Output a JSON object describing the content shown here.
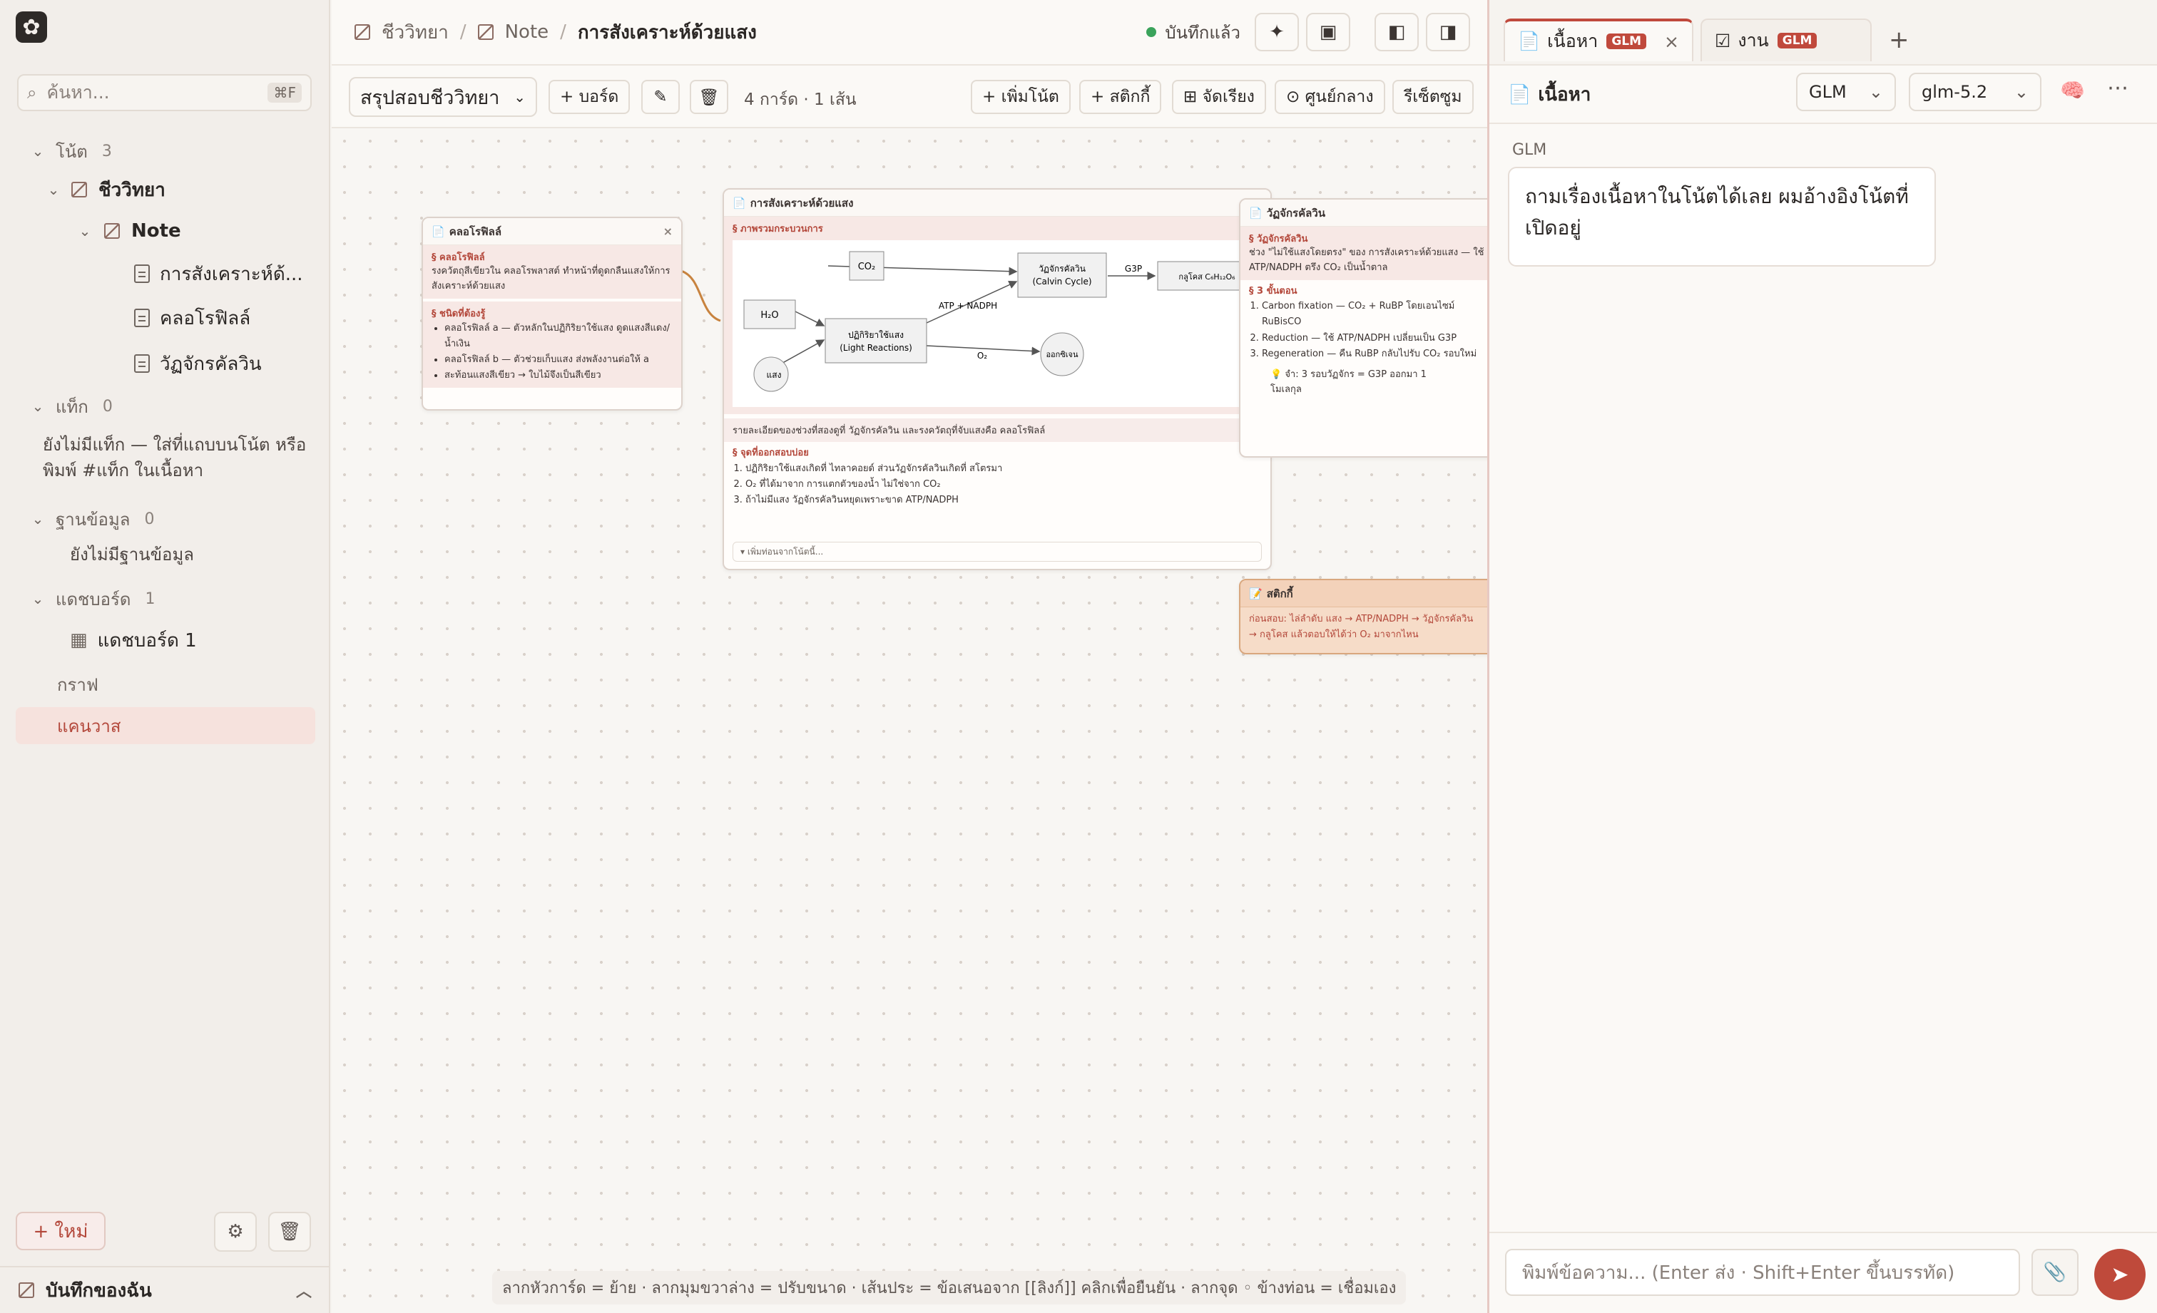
{
  "sidebar": {
    "search_placeholder": "ค้นหา...",
    "search_shortcut": "⌘F",
    "notes": {
      "label": "โน้ต",
      "count": "3",
      "folder": "ชีววิทยา",
      "subfolder": "Note",
      "items": [
        "การสังเคราะห์ด้...",
        "คลอโรฟิลล์",
        "วัฏจักรคัลวิน"
      ]
    },
    "tags": {
      "label": "แท็ก",
      "count": "0",
      "empty": "ยังไม่มีแท็ก — ใส่ที่แถบบนโน้ต หรือพิมพ์ #แท็ก ในเนื้อหา"
    },
    "databases": {
      "label": "ฐานข้อมูล",
      "count": "0",
      "empty": "ยังไม่มีฐานข้อมูล"
    },
    "dashboards": {
      "label": "แดชบอร์ด",
      "count": "1",
      "item": "แดชบอร์ด 1"
    },
    "graph": "กราฟ",
    "canvas": "แคนวาส",
    "new_button": "+ ใหม่",
    "vault_name": "บันทึกของฉัน"
  },
  "header": {
    "breadcrumb": [
      "ชีววิทยา",
      "Note",
      "การสังเคราะห์ด้วยแสง"
    ],
    "save_status": "บันทึกแล้ว"
  },
  "toolbar": {
    "board_select": "สรุปสอบชีววิทยา",
    "add_board": "+ บอร์ด",
    "edit": "✎",
    "delete": "🗑",
    "summary": "4 การ์ด · 1 เส้น",
    "add_note": "+ เพิ่มโน้ต",
    "add_sticky": "+ สติกกี้",
    "arrange": "⊞ จัดเรียง",
    "center": "⊙ ศูนย์กลาง",
    "reset_zoom": "รีเซ็ตซูม"
  },
  "canvas": {
    "card_chloro": {
      "title": "คลอโรฟิลล์",
      "sec1": "§ คลอโรฟิลล์",
      "body1": "รงควัตถุสีเขียวใน คลอโรพลาสต์ ทำหน้าที่ดูดกลืนแสงให้การสังเคราะห์ด้วยแสง",
      "sec2": "§ ชนิดที่ต้องรู้",
      "list": [
        "คลอโรฟิลล์ a — ตัวหลักในปฏิกิริยาใช้แสง ดูดแสงสีแดง/น้ำเงิน",
        "คลอโรฟิลล์ b — ตัวช่วยเก็บแสง ส่งพลังงานต่อให้ a",
        "สะท้อนแสงสีเขียว → ใบไม้จึงเป็นสีเขียว"
      ]
    },
    "card_photo": {
      "title": "การสังเคราะห์ด้วยแสง",
      "sec1": "§ ภาพรวมกระบวนการ",
      "diagram": {
        "co2": "CO₂",
        "calvin": "วัฏจักรคัลวิน (Calvin Cycle)",
        "g3p": "G3P",
        "glucose": "กลูโคส C₆H₁₂O₆",
        "h2o": "H₂O",
        "light_rx": "ปฏิกิริยาใช้แสง (Light Reactions)",
        "atp": "ATP + NADPH",
        "o2": "O₂",
        "oxygen": "ออกซิเจน",
        "sun": "แสง"
      },
      "caption": "รายละเอียดของช่วงที่สองดูที่ วัฏจักรคัลวิน และรงควัตถุที่จับแสงคือ คลอโรฟิลล์",
      "sec2": "§ จุดที่ออกสอบบ่อย",
      "list": [
        "ปฏิกิริยาใช้แสงเกิดที่ ไทลาคอยด์ ส่วนวัฏจักรคัลวินเกิดที่ สโตรมา",
        "O₂ ที่ได้มาจาก การแตกตัวของน้ำ ไม่ใช่จาก CO₂",
        "ถ้าไม่มีแสง วัฏจักรคัลวินหยุดเพราะขาด ATP/NADPH"
      ],
      "footer": "▾ เพิ่มท่อนจากโน้ตนี้..."
    },
    "card_calvin": {
      "title": "วัฏจักรคัลวิน",
      "sec1": "§ วัฏจักรคัลวิน",
      "body1": "ช่วง \"ไม่ใช้แสงโดยตรง\" ของ การสังเคราะห์ด้วยแสง — ใช้ ATP/NADPH ตรึง CO₂ เป็นน้ำตาล",
      "sec2": "§ 3 ขั้นตอน",
      "list": [
        "Carbon fixation — CO₂ + RuBP โดยเอนไซม์ RuBisCO",
        "Reduction — ใช้ ATP/NADPH เปลี่ยนเป็น G3P",
        "Regeneration — คืน RuBP กลับไปรับ CO₂ รอบใหม่"
      ],
      "tip": "💡 จำ: 3 รอบวัฏจักร = G3P ออกมา 1 โมเลกุล"
    },
    "sticky": {
      "title": "สติกกี้",
      "body": "ก่อนสอบ: ไล่ลำดับ แสง → ATP/NADPH → วัฏจักรคัลวิน → กลูโคส แล้วตอบให้ได้ว่า O₂ มาจากไหน"
    },
    "hint": "ลากหัวการ์ด = ย้าย · ลากมุมขวาล่าง = ปรับขนาด · เส้นประ = ข้อเสนอจาก [[ลิงก์]] คลิกเพื่อยืนยัน · ลากจุด ◦ ข้างท่อน = เชื่อมเอง"
  },
  "right_panel": {
    "tab1": "เนื้อหา",
    "tab1_badge": "GLM",
    "tab2": "งาน",
    "tab2_badge": "GLM",
    "title": "เนื้อหา",
    "provider": "GLM",
    "model": "glm-5.2",
    "sender": "GLM",
    "message": "ถามเรื่องเนื้อหาในโน้ตได้เลย ผมอ้างอิงโน้ตที่เปิดอยู่",
    "composer_placeholder": "พิมพ์ข้อความ... (Enter ส่ง · Shift+Enter ขึ้นบรรทัด)"
  },
  "colors": {
    "accent": "#bf4a3b",
    "sidebar_bg": "#f2eeea",
    "active_bg": "#f6e2dd"
  }
}
